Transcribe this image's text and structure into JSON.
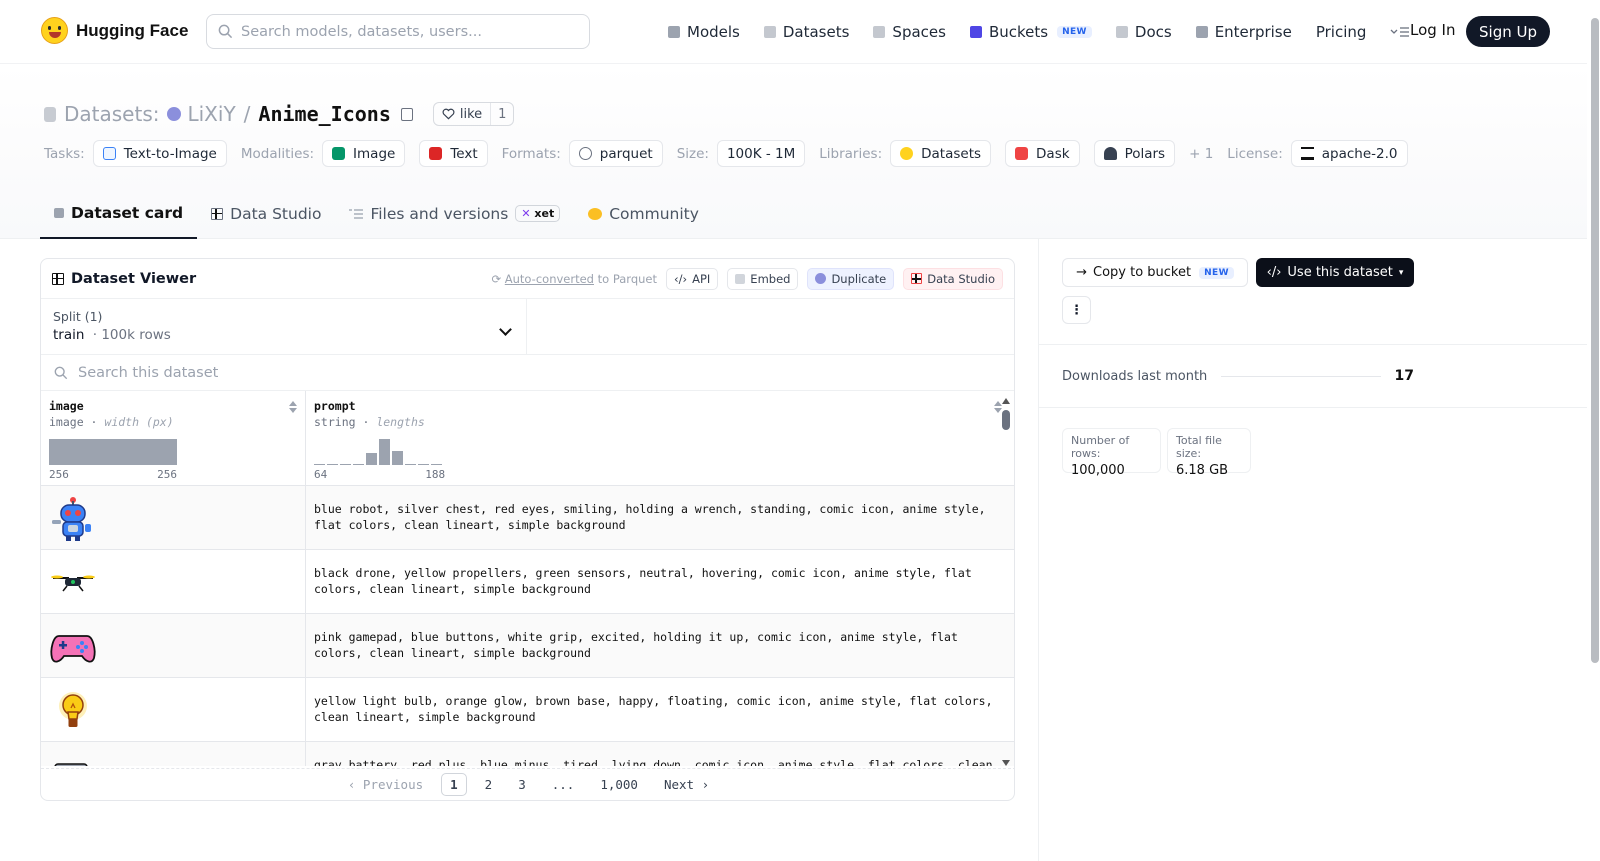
{
  "nav": {
    "brand": "Hugging Face",
    "search_placeholder": "Search models, datasets, users...",
    "links": [
      {
        "label": "Models",
        "icon": "cube-icon",
        "color": "#9ca3af"
      },
      {
        "label": "Datasets",
        "icon": "database-icon",
        "color": "#b8bcc4"
      },
      {
        "label": "Spaces",
        "icon": "grid-icon",
        "color": "#b8bcc4"
      },
      {
        "label": "Buckets",
        "icon": "bucket-icon",
        "color": "#4f46e5"
      },
      {
        "label": "Docs",
        "icon": "book-icon",
        "color": "#b8bcc4"
      },
      {
        "label": "Enterprise",
        "icon": "enterprise-icon",
        "color": "#9ca3af"
      },
      {
        "label": "Pricing",
        "icon": "",
        "color": ""
      }
    ],
    "new_badge": "NEW",
    "login": "Log In",
    "signup": "Sign Up"
  },
  "dataset": {
    "prefix": "Datasets:",
    "owner": "LiXiY",
    "separator": "/",
    "name": "Anime_Icons",
    "like_label": "like",
    "like_count": "1"
  },
  "tags": {
    "tasks_label": "Tasks:",
    "tasks": [
      "Text-to-Image"
    ],
    "modalities_label": "Modalities:",
    "modalities": [
      "Image",
      "Text"
    ],
    "formats_label": "Formats:",
    "formats": [
      "parquet"
    ],
    "size_label": "Size:",
    "size": "100K - 1M",
    "libraries_label": "Libraries:",
    "libraries": [
      "Datasets",
      "Dask",
      "Polars"
    ],
    "libraries_more": "+ 1",
    "license_label": "License:",
    "license": "apache-2.0"
  },
  "tabs": [
    {
      "label": "Dataset card",
      "active": true
    },
    {
      "label": "Data Studio",
      "active": false
    },
    {
      "label": "Files and versions",
      "active": false,
      "badge": "xet"
    },
    {
      "label": "Community",
      "active": false
    }
  ],
  "viewer": {
    "title": "Dataset Viewer",
    "auto_converted": "Auto-converted",
    "to_parquet": "to Parquet",
    "buttons": {
      "api": "API",
      "embed": "Embed",
      "duplicate": "Duplicate",
      "studio": "Data Studio"
    },
    "split_label": "Split (1)",
    "split_value": "train",
    "split_rows": "100k rows",
    "search_placeholder": "Search this dataset",
    "columns": [
      {
        "name": "image",
        "type": "image",
        "stat": "width (px)",
        "min": "256",
        "max": "256"
      },
      {
        "name": "prompt",
        "type": "string",
        "stat": "lengths",
        "min": "64",
        "max": "188",
        "hist": [
          0,
          0,
          0,
          0,
          0.45,
          1.0,
          0.55,
          0,
          0,
          0
        ]
      }
    ],
    "rows": [
      {
        "icon": "robot-icon",
        "prompt": "blue robot, silver chest, red eyes, smiling, holding a wrench, standing, comic icon, anime style, flat colors, clean lineart, simple background"
      },
      {
        "icon": "drone-icon",
        "prompt": "black drone, yellow propellers, green sensors, neutral, hovering, comic icon, anime style, flat colors, clean lineart, simple background"
      },
      {
        "icon": "gamepad-icon",
        "prompt": "pink gamepad, blue buttons, white grip, excited, holding it up, comic icon, anime style, flat colors, clean lineart, simple background"
      },
      {
        "icon": "lightbulb-icon",
        "prompt": "yellow light bulb, orange glow, brown base, happy, floating, comic icon, anime style, flat colors, clean lineart, simple background"
      },
      {
        "icon": "battery-icon",
        "prompt": "gray battery, red plus, blue minus, tired, lying down, comic icon, anime style, flat colors, clean lineart, simple background"
      }
    ],
    "pager": {
      "prev": "Previous",
      "pages": [
        "1",
        "2",
        "3",
        "...",
        "1,000"
      ],
      "next": "Next"
    }
  },
  "sidebar": {
    "copy_to_bucket": "Copy to bucket",
    "new_badge": "NEW",
    "use_dataset": "Use this dataset",
    "downloads_label": "Downloads last month",
    "downloads": "17",
    "rows_label": "Number of rows:",
    "rows": "100,000",
    "size_label": "Total file size:",
    "size": "6.18 GB"
  }
}
